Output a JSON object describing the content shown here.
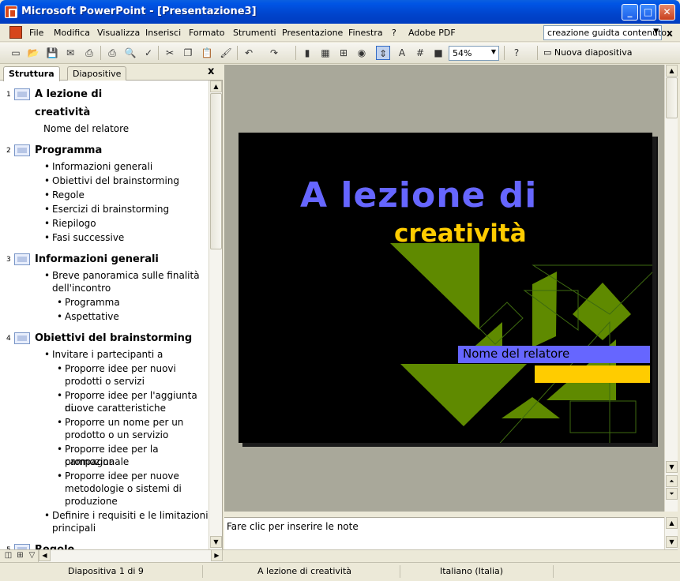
{
  "window": {
    "title": "Microsoft PowerPoint - [Presentazione3]",
    "controls": {
      "minimize": "_",
      "maximize": "□",
      "close": "✕"
    }
  },
  "menubar": {
    "items": [
      "File",
      "Modifica",
      "Visualizza",
      "Inserisci",
      "Formato",
      "Strumenti",
      "Presentazione",
      "Finestra",
      "?",
      "Adobe PDF"
    ],
    "help_box": "creazione guidta contenuto",
    "close_glyph": "x"
  },
  "toolbar": {
    "zoom": "54%",
    "new_slide_label": "Nuova diapositiva"
  },
  "left_pane": {
    "tabs": [
      "Struttura",
      "Diapositive"
    ],
    "active_tab": "Struttura",
    "close_glyph": "x"
  },
  "outline": [
    {
      "num": "1",
      "title_lines": [
        "A lezione di",
        "creatività"
      ],
      "body": [
        {
          "level": 0,
          "bullet": false,
          "lines": [
            "Nome del relatore"
          ]
        }
      ]
    },
    {
      "num": "2",
      "title_lines": [
        "Programma"
      ],
      "body": [
        {
          "level": 1,
          "bullet": true,
          "lines": [
            "Informazioni generali"
          ]
        },
        {
          "level": 1,
          "bullet": true,
          "lines": [
            "Obiettivi del brainstorming"
          ]
        },
        {
          "level": 1,
          "bullet": true,
          "lines": [
            "Regole"
          ]
        },
        {
          "level": 1,
          "bullet": true,
          "lines": [
            "Esercizi di brainstorming"
          ]
        },
        {
          "level": 1,
          "bullet": true,
          "lines": [
            "Riepilogo"
          ]
        },
        {
          "level": 1,
          "bullet": true,
          "lines": [
            "Fasi successive"
          ]
        }
      ]
    },
    {
      "num": "3",
      "title_lines": [
        "Informazioni generali"
      ],
      "body": [
        {
          "level": 1,
          "bullet": true,
          "lines": [
            "Breve panoramica sulle finalità",
            "dell'incontro"
          ]
        },
        {
          "level": 2,
          "bullet": true,
          "lines": [
            "Programma"
          ]
        },
        {
          "level": 2,
          "bullet": true,
          "lines": [
            "Aspettative"
          ]
        }
      ]
    },
    {
      "num": "4",
      "title_lines": [
        "Obiettivi del brainstorming"
      ],
      "body": [
        {
          "level": 1,
          "bullet": true,
          "lines": [
            "Invitare i partecipanti a"
          ]
        },
        {
          "level": 2,
          "bullet": true,
          "lines": [
            "Proporre idee per nuovi",
            "prodotti o servizi"
          ]
        },
        {
          "level": 2,
          "bullet": true,
          "lines": [
            "Proporre idee per l'aggiunta di",
            "nuove caratteristiche"
          ]
        },
        {
          "level": 2,
          "bullet": true,
          "lines": [
            "Proporre un nome per un",
            "prodotto o un servizio"
          ]
        },
        {
          "level": 2,
          "bullet": true,
          "lines": [
            "Proporre idee per la campagna",
            "promozionale"
          ]
        },
        {
          "level": 2,
          "bullet": true,
          "lines": [
            "Proporre idee per nuove",
            "metodologie o sistemi di",
            "produzione"
          ]
        },
        {
          "level": 1,
          "bullet": true,
          "lines": [
            "Definire i requisiti e le limitazioni",
            "principali"
          ]
        }
      ]
    },
    {
      "num": "5",
      "title_lines": [
        "Regole"
      ],
      "body": []
    }
  ],
  "slide": {
    "title_line1": "A lezione di",
    "title_line2": "creatività",
    "subtitle": "Nome del relatore",
    "colors": {
      "background": "#000000",
      "title": "#6666ff",
      "accent": "#ffcc00",
      "shapes": "#5f8a00"
    }
  },
  "notes": {
    "placeholder": "Fare clic per inserire le note"
  },
  "statusbar": {
    "slide_info": "Diapositiva 1 di 9",
    "design": "A lezione di creatività",
    "language": "Italiano (Italia)"
  }
}
